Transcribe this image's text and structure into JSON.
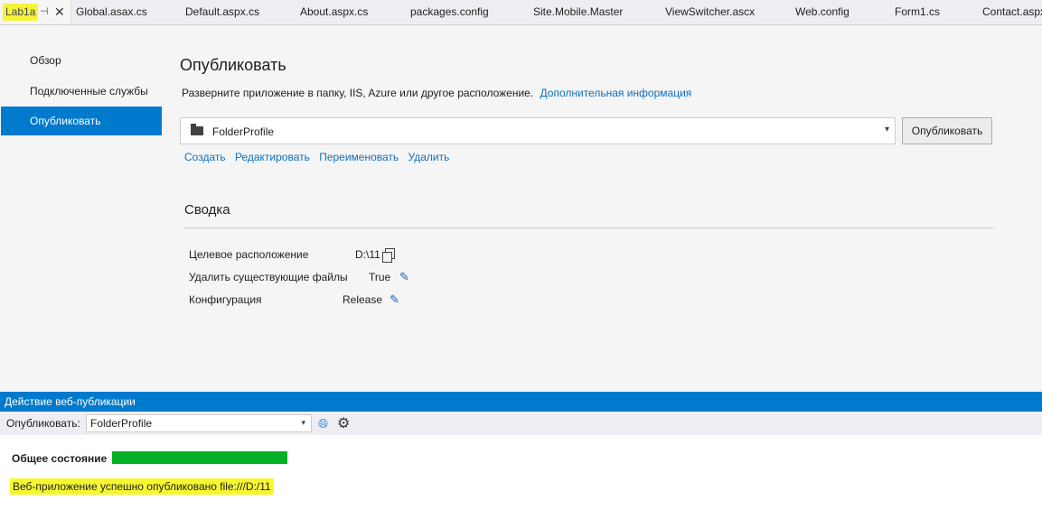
{
  "tabs": {
    "active": "Lab1a",
    "items": [
      "Global.asax.cs",
      "Default.aspx.cs",
      "About.aspx.cs",
      "packages.config",
      "Site.Mobile.Master",
      "ViewSwitcher.ascx",
      "Web.config",
      "Form1.cs",
      "Contact.aspx"
    ],
    "pin_glyph": "⊣",
    "close_glyph": "✕"
  },
  "nav": {
    "items": [
      "Обзор",
      "Подключенные службы",
      "Опубликовать"
    ],
    "selected_index": 2
  },
  "publish": {
    "title": "Опубликовать",
    "description": "Разверните приложение в папку, IIS, Azure или другое расположение.",
    "more_info_link": "Дополнительная информация",
    "profile_value": "FolderProfile",
    "publish_button": "Опубликовать",
    "actions": [
      "Создать",
      "Редактировать",
      "Переименовать",
      "Удалить"
    ]
  },
  "summary": {
    "title": "Сводка",
    "rows": [
      {
        "key": "Целевое расположение",
        "value": "D:\\11",
        "icon": "copy-icon"
      },
      {
        "key": "Удалить существующие файлы",
        "value": "True",
        "icon": "pencil-icon"
      },
      {
        "key": "Конфигурация",
        "value": "Release",
        "icon": "pencil-icon"
      }
    ]
  },
  "panel": {
    "title": "Действие веб-публикации",
    "toolbar_label": "Опубликовать:",
    "toolbar_profile": "FolderProfile",
    "status_label": "Общее состояние",
    "progress_fraction": 1.0,
    "result_message": "Веб-приложение успешно опубликовано file:///D:/11"
  },
  "colors": {
    "accent": "#007acc",
    "link": "#0e70c0",
    "progress": "#06b025",
    "highlight": "#f7f730"
  }
}
